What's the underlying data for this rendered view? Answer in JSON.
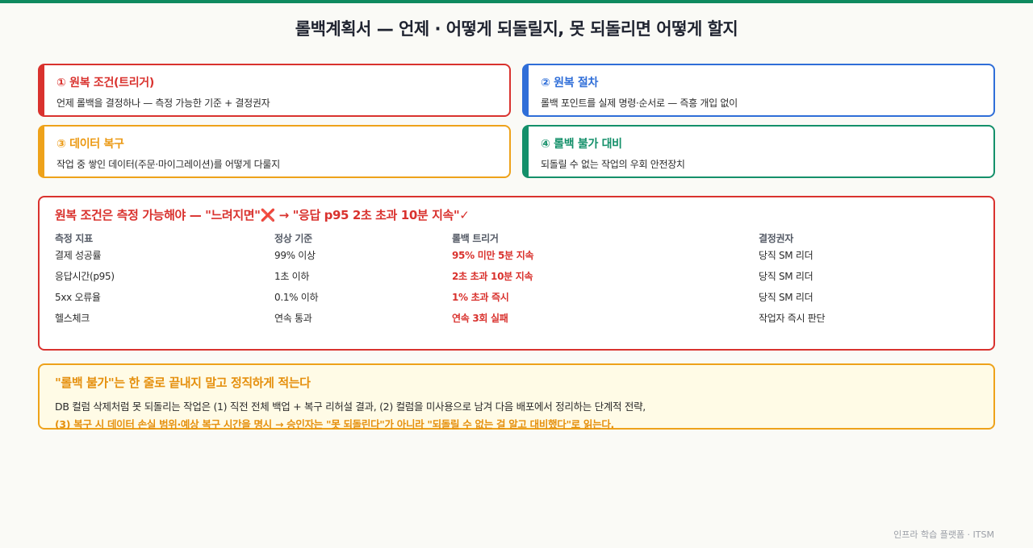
{
  "page": {
    "title": "롤백계획서 — 언제 · 어떻게 되돌릴지, 못 되돌리면 어떻게 할지",
    "footer": "인프라 학습 플랫폼 · ITSM"
  },
  "colors": {
    "accent_green": "#0f8a5f",
    "red": "#d9322e",
    "blue": "#2f6ed8",
    "orange": "#eea21a",
    "green": "#14906a"
  },
  "cards": [
    {
      "title": "① 원복 조건(트리거)",
      "desc": "언제 롤백을 결정하나 — 측정 가능한 기준 + 결정권자"
    },
    {
      "title": "② 원복 절차",
      "desc": "롤백 포인트를 실제 명령·순서로 — 즉흥 개입 없이"
    },
    {
      "title": "③ 데이터 복구",
      "desc": "작업 중 쌓인 데이터(주문·마이그레이션)를 어떻게 다룰지"
    },
    {
      "title": "④ 롤백 불가 대비",
      "desc": "되돌릴 수 없는 작업의 우회 안전장치"
    }
  ],
  "criteria": {
    "title": "원복 조건은 측정 가능해야 — \"느려지면\"❌ → \"응답 p95 2초 초과 10분 지속\"✓",
    "headers": [
      "측정 지표",
      "정상 기준",
      "롤백 트리거",
      "결정권자"
    ],
    "rows": [
      [
        "결제 성공률",
        "99% 이상",
        "95% 미만 5분 지속",
        "당직 SM 리더"
      ],
      [
        "응답시간(p95)",
        "1초 이하",
        "2초 초과 10분 지속",
        "당직 SM 리더"
      ],
      [
        "5xx 오류율",
        "0.1% 이하",
        "1% 초과 즉시",
        "당직 SM 리더"
      ],
      [
        "헬스체크",
        "연속 통과",
        "연속 3회 실패",
        "작업자 즉시 판단"
      ]
    ]
  },
  "note": {
    "title": "\"롤백 불가\"는 한 줄로 끝내지 말고 정직하게 적는다",
    "line1": "DB 컬럼 삭제처럼 못 되돌리는 작업은 (1) 직전 전체 백업 + 복구 리허설 결과, (2) 컬럼을 미사용으로 남겨 다음 배포에서 정리하는 단계적 전략,",
    "line2": "(3) 복구 시 데이터 손실 범위·예상 복구 시간을 명시 → 승인자는 \"못 되돌린다\"가 아니라 \"되돌릴 수 없는 걸 알고 대비했다\"로 읽는다."
  }
}
